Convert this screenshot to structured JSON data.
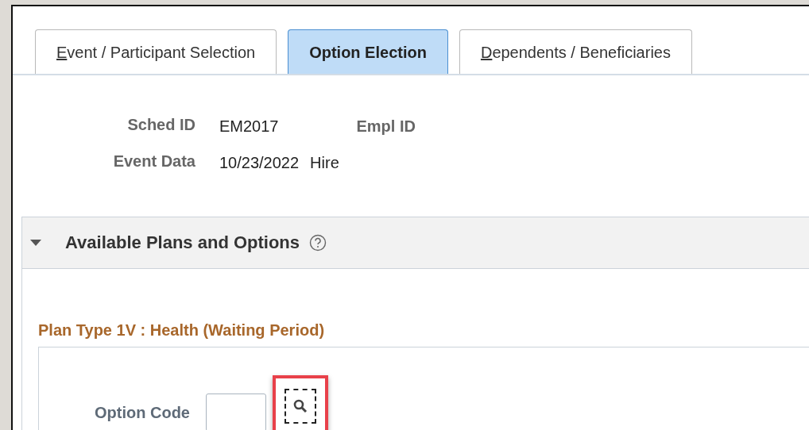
{
  "tabs": [
    {
      "label": "Event / Participant Selection",
      "selected": false,
      "underlined_initial": true
    },
    {
      "label": "Option Election",
      "selected": true,
      "underlined_initial": false
    },
    {
      "label": "Dependents / Beneficiaries",
      "selected": false,
      "underlined_initial": true
    }
  ],
  "fields": [
    {
      "label": "Sched ID",
      "values": [
        "EM2017"
      ]
    },
    {
      "label": "Event Data",
      "values": [
        "10/23/2022",
        "Hire"
      ]
    }
  ],
  "empl_id": {
    "label": "Empl ID"
  },
  "section": {
    "title": "Available Plans and Options",
    "expanded": true
  },
  "plan": {
    "title": "Plan Type 1V : Health (Waiting Period)",
    "option_code": {
      "label": "Option Code",
      "highlighted": true
    }
  }
}
